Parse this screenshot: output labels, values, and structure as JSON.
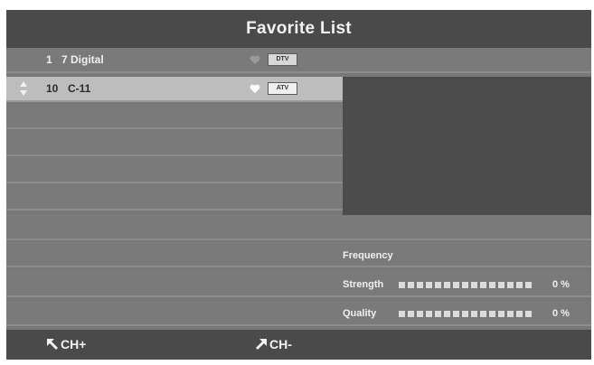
{
  "title": "Favorite List",
  "channels": [
    {
      "number": "1",
      "name": "7 Digital",
      "type": "DTV",
      "selected": false
    },
    {
      "number": "10",
      "name": "C-11",
      "type": "ATV",
      "selected": true
    }
  ],
  "signal": {
    "frequency_label": "Frequency",
    "strength_label": "Strength",
    "strength_value": "0 %",
    "quality_label": "Quality",
    "quality_value": "0 %"
  },
  "footer": {
    "ch_up_label": "CH+",
    "ch_down_label": "CH-"
  },
  "colors": {
    "background": "#787878",
    "title_bar": "#4a4a4a",
    "selected_row": "#bdbdbd",
    "preview": "#4c4c4c"
  },
  "icons": [
    "up-down-arrows-icon",
    "heart-icon",
    "red-button-icon",
    "green-button-icon"
  ]
}
